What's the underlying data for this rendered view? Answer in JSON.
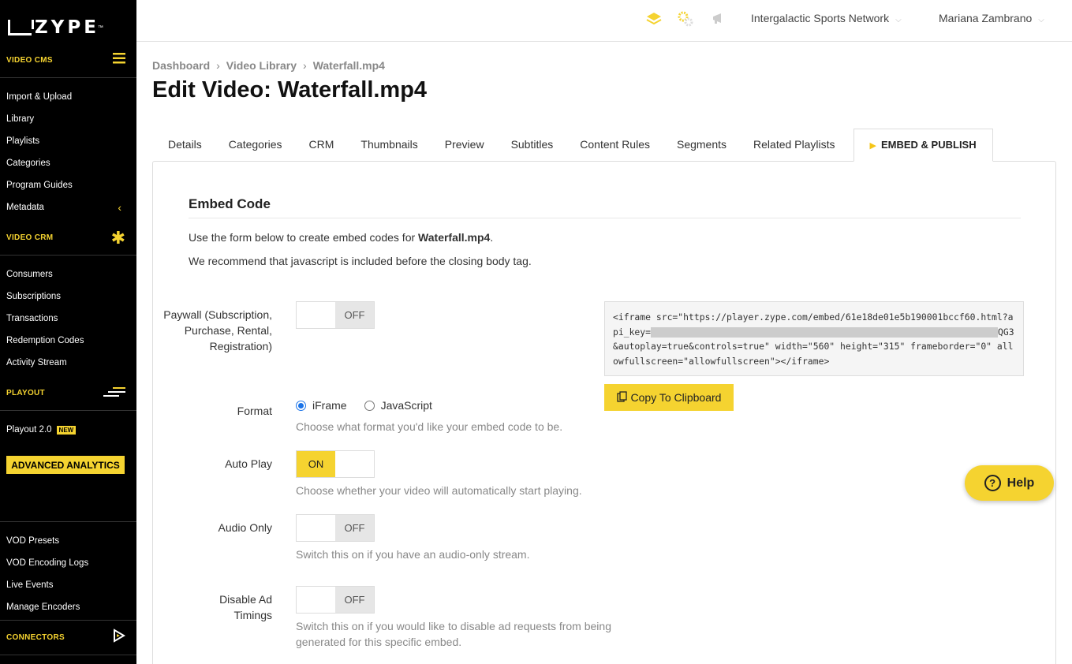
{
  "brand": {
    "logo_text": "ZYPE",
    "tm": "™",
    "accent": "#f5d330"
  },
  "sidebar": {
    "sections": [
      {
        "label": "VIDEO CMS",
        "icon": "hamburger-icon",
        "items": [
          "Import & Upload",
          "Library",
          "Playlists",
          "Categories",
          "Program Guides",
          "Metadata"
        ]
      },
      {
        "label": "VIDEO CRM",
        "icon": "asterisk-icon",
        "items": [
          "Consumers",
          "Subscriptions",
          "Transactions",
          "Redemption Codes",
          "Activity Stream"
        ]
      },
      {
        "label": "PLAYOUT",
        "icon": "playout-icon",
        "items": [
          "Playout 2.0"
        ]
      },
      {
        "label": "CONNECTORS",
        "icon": "play-outline-icon"
      }
    ],
    "new_badge": "NEW",
    "advanced_analytics": "ADVANCED ANALYTICS",
    "bottom_items": [
      "VOD Presets",
      "VOD Encoding Logs",
      "Live Events",
      "Manage Encoders"
    ]
  },
  "topbar": {
    "icons": [
      "layers-icon",
      "gears-icon",
      "megaphone-icon"
    ],
    "network": "Intergalactic Sports Network",
    "user": "Mariana Zambrano"
  },
  "breadcrumb": [
    "Dashboard",
    "Video Library",
    "Waterfall.mp4"
  ],
  "title": "Edit Video: Waterfall.mp4",
  "tabs": [
    "Details",
    "Categories",
    "CRM",
    "Thumbnails",
    "Preview",
    "Subtitles",
    "Content Rules",
    "Segments",
    "Related Playlists",
    "EMBED & PUBLISH"
  ],
  "embed": {
    "section_title": "Embed Code",
    "intro_prefix": "Use the form below to create embed codes for ",
    "intro_file": "Waterfall.mp4",
    "intro_suffix": ".",
    "intro2": "We recommend that javascript is included before the closing body tag.",
    "code_part1": "<iframe src=\"https://player.zype.com/embed/61e18de01e5b190001bccf60.html?api_key=",
    "code_part2": "QG3&autoplay=true&controls=true\" width=\"560\" height=\"315\" frameborder=\"0\" allowfullscreen=\"allowfullscreen\"></iframe>",
    "copy_label": "Copy To Clipboard",
    "fields": {
      "paywall": {
        "label": "Paywall (Subscription, Purchase, Rental, Registration)",
        "state": "OFF"
      },
      "format": {
        "label": "Format",
        "options": [
          "iFrame",
          "JavaScript"
        ],
        "selected": "iFrame",
        "hint": "Choose what format you'd like your embed code to be."
      },
      "autoplay": {
        "label": "Auto Play",
        "state": "ON",
        "hint": "Choose whether your video will automatically start playing."
      },
      "audio_only": {
        "label": "Audio Only",
        "state": "OFF",
        "hint": "Switch this on if you have an audio-only stream."
      },
      "disable_ad": {
        "label": "Disable Ad Timings",
        "state": "OFF",
        "hint": "Switch this on if you would like to disable ad requests from being generated for this specific embed."
      }
    }
  },
  "help": "Help"
}
